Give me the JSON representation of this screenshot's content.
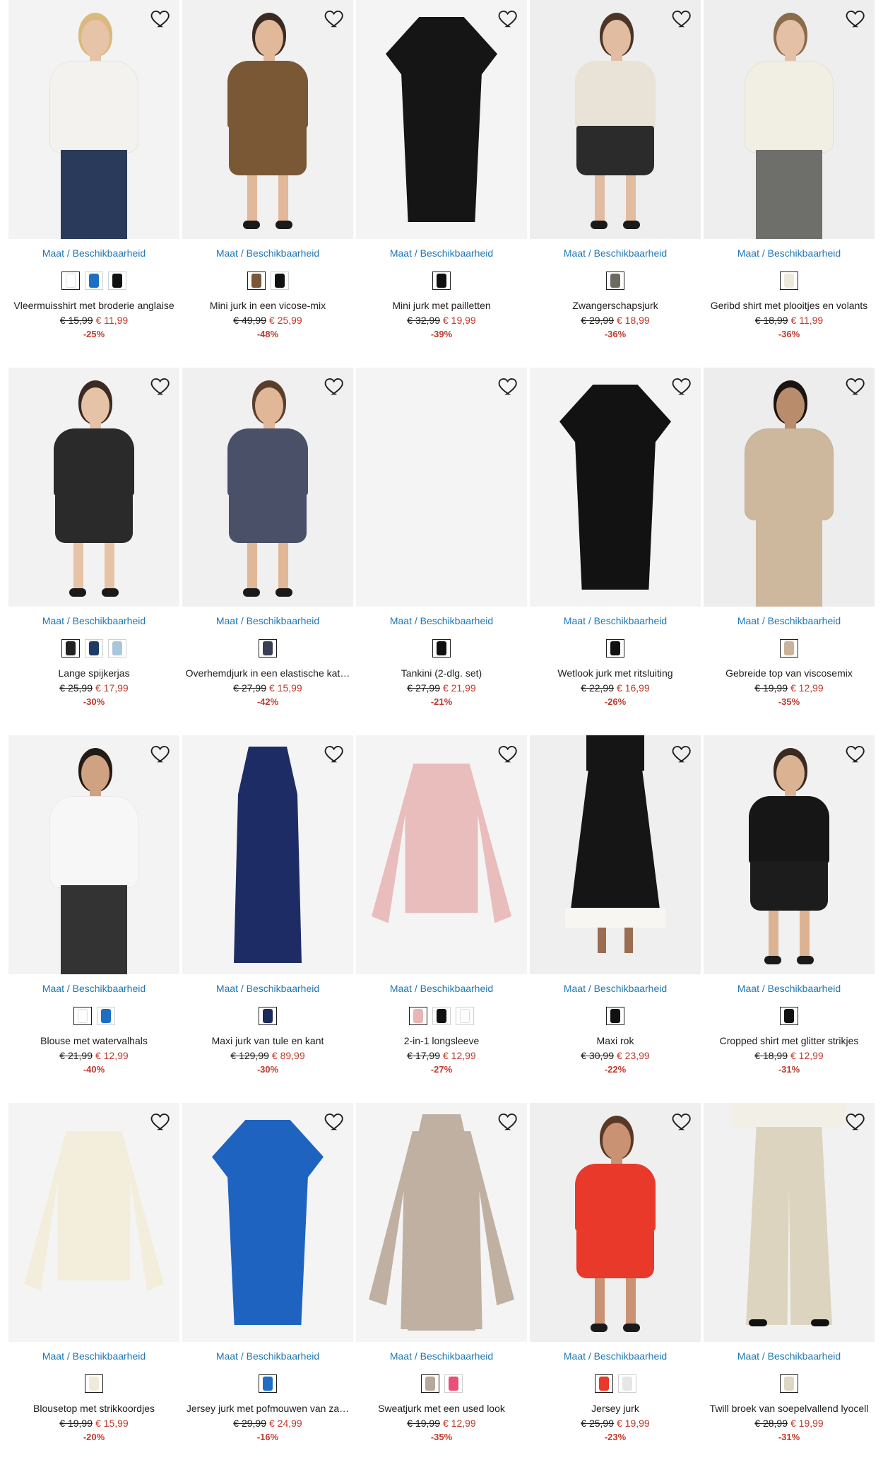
{
  "availability_label": "Maat / Beschikbaarheid",
  "products": [
    {
      "name": "Vleermuisshirt met broderie anglaise",
      "old": "€ 15,99",
      "new": "€ 11,99",
      "disc": "-25%",
      "swatches": [
        "#ffffff",
        "#1e6fc4",
        "#111111"
      ],
      "colors": {
        "bg": "#f3f3f3",
        "top": "#f4f2ee",
        "bottom": "#2a3a5a",
        "skin": "#e7c3a8",
        "hair": "#d9b97c"
      },
      "icon": "woman-top"
    },
    {
      "name": "Mini jurk in een vicose-mix",
      "old": "€ 49,99",
      "new": "€ 25,99",
      "disc": "-48%",
      "swatches": [
        "#7a5836",
        "#111111"
      ],
      "colors": {
        "bg": "#f1f1f1",
        "top": "#7a5836",
        "bottom": "#7a5836",
        "skin": "#e2b89a",
        "hair": "#3a2a22"
      },
      "icon": "woman-dress"
    },
    {
      "name": "Mini jurk met pailletten",
      "old": "€ 32,99",
      "new": "€ 19,99",
      "disc": "-39%",
      "swatches": [
        "#111111"
      ],
      "colors": {
        "bg": "#f4f4f4",
        "top": "#151515",
        "bottom": "#151515",
        "skin": "",
        "hair": ""
      },
      "icon": "flat-dress"
    },
    {
      "name": "Zwangerschapsjurk",
      "old": "€ 29,99",
      "new": "€ 18,99",
      "disc": "-36%",
      "swatches": [
        "#6b6b60"
      ],
      "colors": {
        "bg": "#eeeeee",
        "top": "#e8e3d6",
        "bottom": "#2b2b2b",
        "skin": "#e2bca0",
        "hair": "#4a3526"
      },
      "icon": "woman-dress"
    },
    {
      "name": "Geribd shirt met plooitjes en volants",
      "old": "€ 18,99",
      "new": "€ 11,99",
      "disc": "-36%",
      "swatches": [
        "#eeeadb"
      ],
      "colors": {
        "bg": "#eeeeee",
        "top": "#f1eee3",
        "bottom": "#6e6e6a",
        "skin": "#e4c1a6",
        "hair": "#8a6b4a"
      },
      "icon": "woman-top"
    },
    {
      "name": "Lange spijkerjas",
      "old": "€ 25,99",
      "new": "€ 17,99",
      "disc": "-30%",
      "swatches": [
        "#222222",
        "#1f3b66",
        "#a9c7dc"
      ],
      "colors": {
        "bg": "#f2f2f2",
        "top": "#2a2a2a",
        "bottom": "#2a2a2a",
        "skin": "#e6c3a6",
        "hair": "#3a2a22"
      },
      "icon": "woman-dress"
    },
    {
      "name": "Overhemdjurk in een elastische kat…",
      "old": "€ 27,99",
      "new": "€ 15,99",
      "disc": "-42%",
      "swatches": [
        "#3a3f55"
      ],
      "colors": {
        "bg": "#f0f0f0",
        "top": "#4a5068",
        "bottom": "#4a5068",
        "skin": "#e0b897",
        "hair": "#5a3e2b"
      },
      "icon": "woman-dress"
    },
    {
      "name": "Tankini (2-dlg. set)",
      "old": "€ 27,99",
      "new": "€ 21,99",
      "disc": "-21%",
      "swatches": [
        "#111111"
      ],
      "colors": {
        "bg": "#f4f4f4",
        "top": "",
        "bottom": "",
        "skin": "",
        "hair": ""
      },
      "icon": "empty"
    },
    {
      "name": "Wetlook jurk met ritsluiting",
      "old": "€ 22,99",
      "new": "€ 16,99",
      "disc": "-26%",
      "swatches": [
        "#111111"
      ],
      "colors": {
        "bg": "#f3f3f3",
        "top": "#121212",
        "bottom": "#121212",
        "skin": "",
        "hair": ""
      },
      "icon": "flat-dress"
    },
    {
      "name": "Gebreide top van viscosemix",
      "old": "€ 19,99",
      "new": "€ 12,99",
      "disc": "-35%",
      "swatches": [
        "#c9b49a"
      ],
      "colors": {
        "bg": "#ededed",
        "top": "#cdb79d",
        "bottom": "#cdb79d",
        "skin": "#b98c6b",
        "hair": "#1c1410"
      },
      "icon": "woman-top"
    },
    {
      "name": "Blouse met watervalhals",
      "old": "€ 21,99",
      "new": "€ 12,99",
      "disc": "-40%",
      "swatches": [
        "#ffffff",
        "#1e6fc4"
      ],
      "colors": {
        "bg": "#f3f3f3",
        "top": "#f7f7f7",
        "bottom": "#333333",
        "skin": "#cfa282",
        "hair": "#241a14"
      },
      "icon": "woman-top"
    },
    {
      "name": "Maxi jurk van tule en kant",
      "old": "€ 129,99",
      "new": "€ 89,99",
      "disc": "-30%",
      "swatches": [
        "#1c2a5e"
      ],
      "colors": {
        "bg": "#f4f4f4",
        "top": "#1e2c66",
        "bottom": "#1e2c66",
        "skin": "",
        "hair": ""
      },
      "icon": "flat-long"
    },
    {
      "name": "2-in-1 longsleeve",
      "old": "€ 17,99",
      "new": "€ 12,99",
      "disc": "-27%",
      "swatches": [
        "#e8b7b5",
        "#111111",
        "#ffffff"
      ],
      "colors": {
        "bg": "#f4f4f4",
        "top": "#e9bdbb",
        "bottom": "#e9bdbb",
        "skin": "",
        "hair": ""
      },
      "icon": "flat-top"
    },
    {
      "name": "Maxi rok",
      "old": "€ 30,99",
      "new": "€ 23,99",
      "disc": "-22%",
      "swatches": [
        "#111111"
      ],
      "colors": {
        "bg": "#efefef",
        "top": "#151515",
        "bottom": "#151515",
        "skin": "#9a6c50",
        "hair": ""
      },
      "icon": "woman-skirt"
    },
    {
      "name": "Cropped shirt met glitter strikjes",
      "old": "€ 18,99",
      "new": "€ 12,99",
      "disc": "-31%",
      "swatches": [
        "#111111"
      ],
      "colors": {
        "bg": "#f1f1f1",
        "top": "#161616",
        "bottom": "#1c1c1c",
        "skin": "#dcb392",
        "hair": "#3a2a22"
      },
      "icon": "woman-dress"
    },
    {
      "name": "Blousetop met strikkoordjes",
      "old": "€ 19,99",
      "new": "€ 15,99",
      "disc": "-20%",
      "swatches": [
        "#f0ead8"
      ],
      "colors": {
        "bg": "#f4f4f4",
        "top": "#f3eedc",
        "bottom": "#f3eedc",
        "skin": "",
        "hair": ""
      },
      "icon": "flat-top"
    },
    {
      "name": "Jersey jurk met pofmouwen van za…",
      "old": "€ 29,99",
      "new": "€ 24,99",
      "disc": "-16%",
      "swatches": [
        "#1e6fc4"
      ],
      "colors": {
        "bg": "#f4f4f4",
        "top": "#1f63c0",
        "bottom": "#1f63c0",
        "skin": "",
        "hair": ""
      },
      "icon": "flat-dress"
    },
    {
      "name": "Sweatjurk met een used look",
      "old": "€ 19,99",
      "new": "€ 12,99",
      "disc": "-35%",
      "swatches": [
        "#b8a89a",
        "#e8507a"
      ],
      "colors": {
        "bg": "#f4f4f4",
        "top": "#bfb0a2",
        "bottom": "#bfb0a2",
        "skin": "",
        "hair": ""
      },
      "icon": "flat-long"
    },
    {
      "name": "Jersey jurk",
      "old": "€ 25,99",
      "new": "€ 19,99",
      "disc": "-23%",
      "swatches": [
        "#e8392a",
        "#e6e6e6"
      ],
      "colors": {
        "bg": "#efefef",
        "top": "#e8392a",
        "bottom": "#e8392a",
        "skin": "#c99272",
        "hair": "#5a3826"
      },
      "icon": "woman-dress"
    },
    {
      "name": "Twill broek van soepelvallend lyocell",
      "old": "€ 28,99",
      "new": "€ 19,99",
      "disc": "-31%",
      "swatches": [
        "#e0d7c3"
      ],
      "colors": {
        "bg": "#f1f1f1",
        "top": "#f2efe7",
        "bottom": "#ddd4c0",
        "skin": "#e3bea2",
        "hair": ""
      },
      "icon": "woman-pants"
    }
  ]
}
